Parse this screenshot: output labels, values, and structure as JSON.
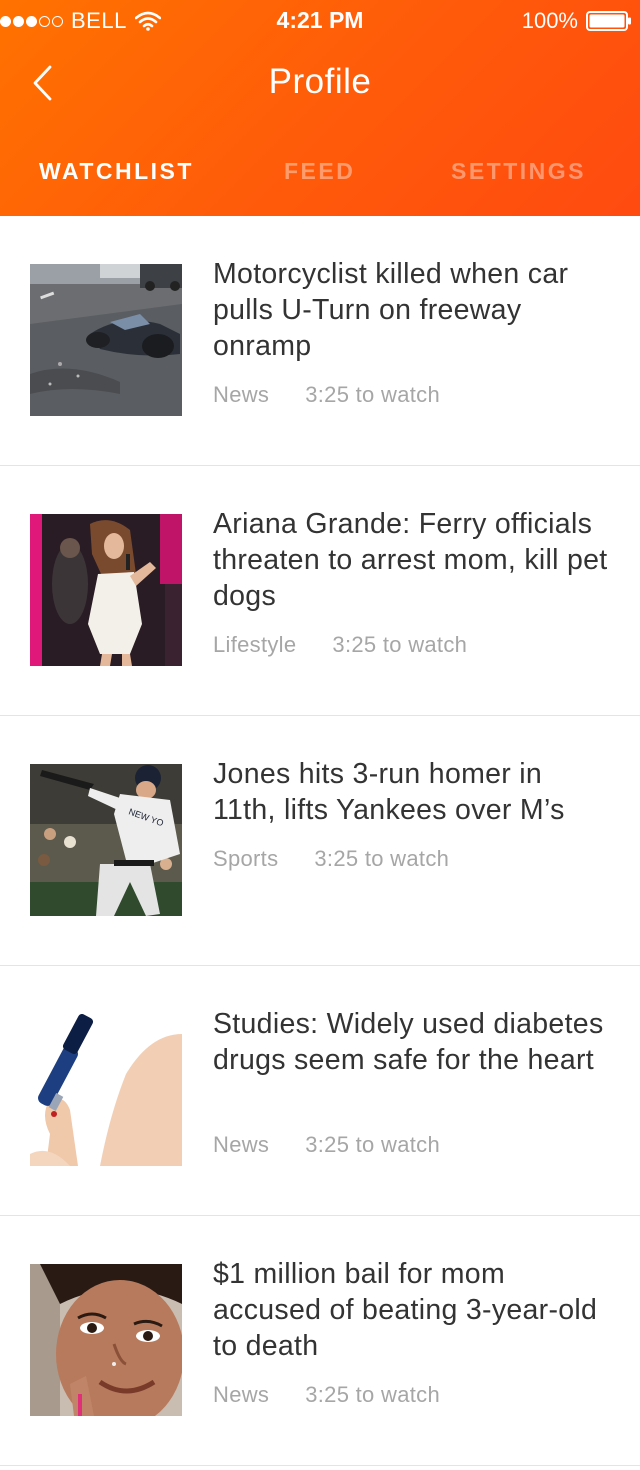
{
  "status_bar": {
    "carrier": "BELL",
    "time": "4:21 PM",
    "battery": "100%"
  },
  "nav": {
    "title": "Profile",
    "back_icon": "chevron-left-icon"
  },
  "tabs": [
    {
      "label": "WATCHLIST",
      "active": true
    },
    {
      "label": "FEED",
      "active": false
    },
    {
      "label": "SETTINGS",
      "active": false
    }
  ],
  "colors": {
    "header_start": "#ff7200",
    "header_end": "#ff4a10",
    "title_text": "#333333",
    "meta_text": "#a6a6a6"
  },
  "items": [
    {
      "title": "Motorcyclist killed when car pulls U-Turn on freeway onramp",
      "category": "News",
      "duration": "3:25 to watch"
    },
    {
      "title": "Ariana Grande: Ferry officials threaten to arrest mom, kill pet dogs",
      "category": "Lifestyle",
      "duration": "3:25 to watch"
    },
    {
      "title": "Jones hits 3-run homer in 11th, lifts Yankees over M’s",
      "category": "Sports",
      "duration": "3:25 to watch"
    },
    {
      "title": "Studies: Widely used diabetes drugs seem safe for the heart",
      "category": "News",
      "duration": "3:25 to watch"
    },
    {
      "title": "$1 million bail for mom accused of beating 3-year-old to death",
      "category": "News",
      "duration": "3:25 to watch"
    }
  ]
}
